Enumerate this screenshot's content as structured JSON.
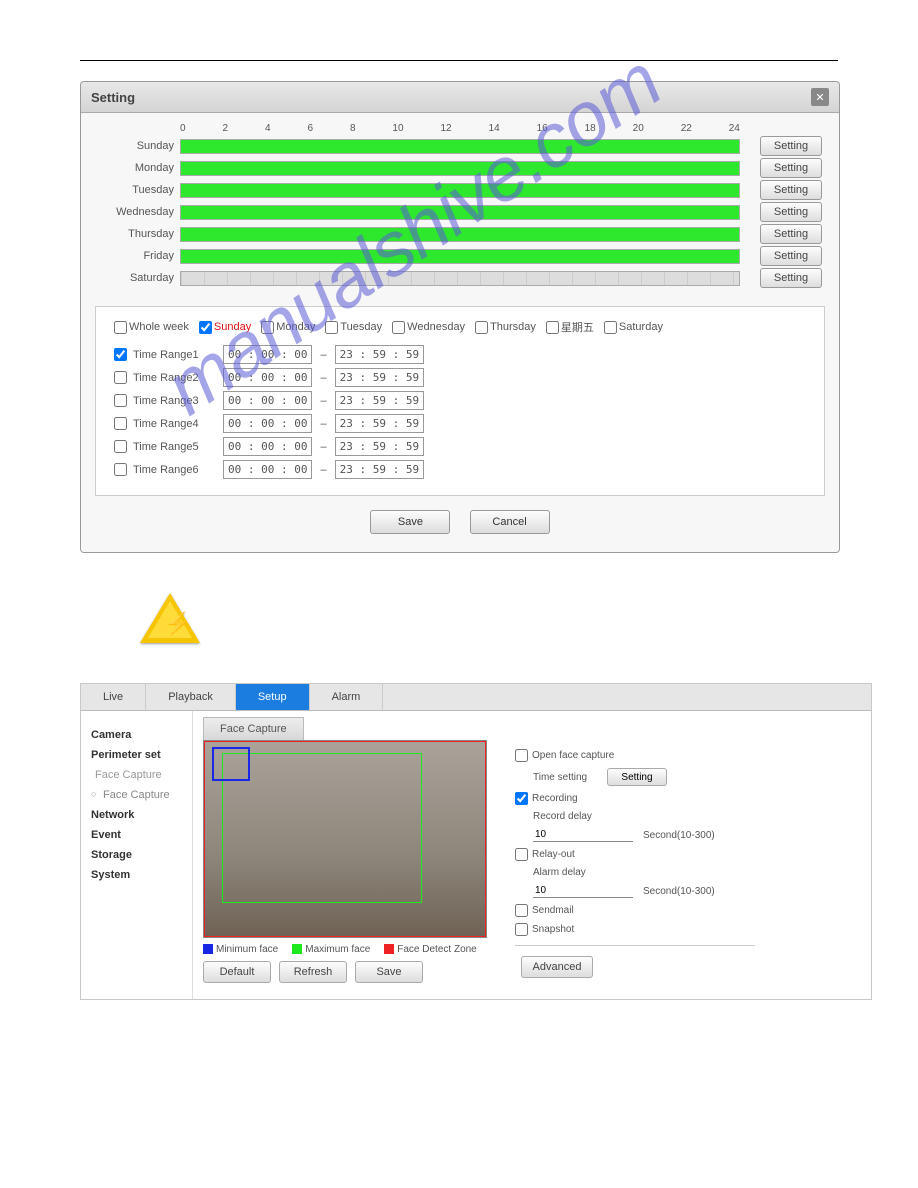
{
  "watermark": "manualshive.com",
  "dialog": {
    "title": "Setting",
    "hours": [
      "0",
      "2",
      "4",
      "6",
      "8",
      "10",
      "12",
      "14",
      "16",
      "18",
      "20",
      "22",
      "24"
    ],
    "days": [
      {
        "label": "Sunday",
        "filled": true,
        "btn": "Setting"
      },
      {
        "label": "Monday",
        "filled": true,
        "btn": "Setting"
      },
      {
        "label": "Tuesday",
        "filled": true,
        "btn": "Setting"
      },
      {
        "label": "Wednesday",
        "filled": true,
        "btn": "Setting"
      },
      {
        "label": "Thursday",
        "filled": true,
        "btn": "Setting"
      },
      {
        "label": "Friday",
        "filled": true,
        "btn": "Setting"
      },
      {
        "label": "Saturday",
        "filled": false,
        "btn": "Setting"
      }
    ],
    "weekChecks": [
      {
        "label": "Whole week",
        "checked": false
      },
      {
        "label": "Sunday",
        "checked": true,
        "red": true
      },
      {
        "label": "Monday",
        "checked": false
      },
      {
        "label": "Tuesday",
        "checked": false
      },
      {
        "label": "Wednesday",
        "checked": false
      },
      {
        "label": "Thursday",
        "checked": false
      },
      {
        "label": "星期五",
        "checked": false
      },
      {
        "label": "Saturday",
        "checked": false
      }
    ],
    "ranges": [
      {
        "label": "Time Range1",
        "checked": true,
        "from": "00 : 00 : 00",
        "to": "23 : 59 : 59"
      },
      {
        "label": "Time Range2",
        "checked": false,
        "from": "00 : 00 : 00",
        "to": "23 : 59 : 59"
      },
      {
        "label": "Time Range3",
        "checked": false,
        "from": "00 : 00 : 00",
        "to": "23 : 59 : 59"
      },
      {
        "label": "Time Range4",
        "checked": false,
        "from": "00 : 00 : 00",
        "to": "23 : 59 : 59"
      },
      {
        "label": "Time Range5",
        "checked": false,
        "from": "00 : 00 : 00",
        "to": "23 : 59 : 59"
      },
      {
        "label": "Time Range6",
        "checked": false,
        "from": "00 : 00 : 00",
        "to": "23 : 59 : 59"
      }
    ],
    "save": "Save",
    "cancel": "Cancel"
  },
  "app": {
    "tabs": [
      "Live",
      "Playback",
      "Setup",
      "Alarm"
    ],
    "activeTab": "Setup",
    "sidebar": [
      {
        "label": "Camera",
        "bold": true
      },
      {
        "label": "Perimeter set",
        "bold": true
      },
      {
        "label": "Face Capture",
        "sub": true
      },
      {
        "label": "Face Capture",
        "sel": true
      },
      {
        "label": "Network",
        "bold": true
      },
      {
        "label": "Event",
        "bold": true
      },
      {
        "label": "Storage",
        "bold": true
      },
      {
        "label": "System",
        "bold": true
      }
    ],
    "subtab": "Face Capture",
    "legend": {
      "min": "Minimum face",
      "max": "Maximum face",
      "zone": "Face Detect Zone"
    },
    "buttons": {
      "default": "Default",
      "refresh": "Refresh",
      "save": "Save"
    },
    "opts": {
      "openFace": "Open face capture",
      "timeSetting": "Time setting",
      "settingBtn": "Setting",
      "recording": "Recording",
      "recordDelay": "Record delay",
      "val1": "10",
      "unit1": "Second(10-300)",
      "relay": "Relay-out",
      "alarmDelay": "Alarm delay",
      "val2": "10",
      "unit2": "Second(10-300)",
      "sendmail": "Sendmail",
      "snapshot": "Snapshot",
      "advanced": "Advanced"
    }
  }
}
